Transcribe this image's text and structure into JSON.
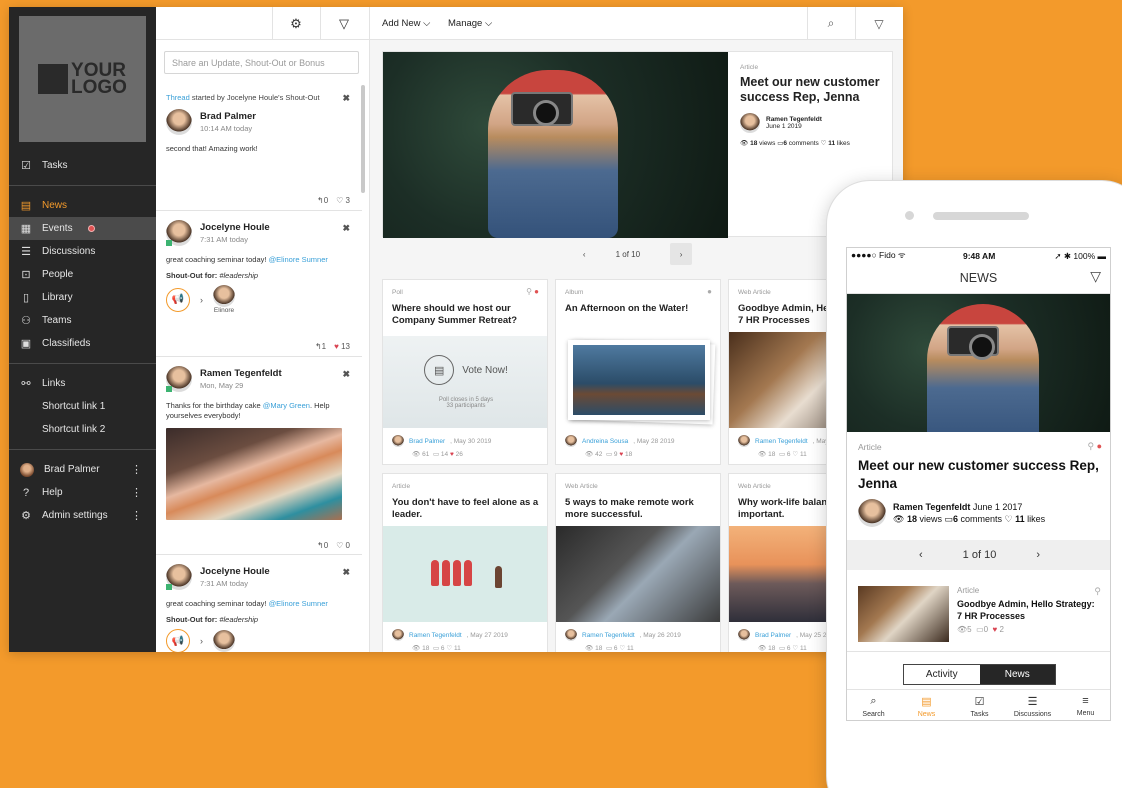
{
  "sidebar": {
    "logo_text": "YOUR LOGO",
    "items": [
      {
        "label": "Tasks",
        "icon": "tasks-icon"
      },
      {
        "label": "News",
        "icon": "news-icon"
      },
      {
        "label": "Events",
        "icon": "calendar-icon"
      },
      {
        "label": "Discussions",
        "icon": "discussions-icon"
      },
      {
        "label": "People",
        "icon": "people-icon"
      },
      {
        "label": "Library",
        "icon": "library-icon"
      },
      {
        "label": "Teams",
        "icon": "teams-icon"
      },
      {
        "label": "Classifieds",
        "icon": "classifieds-icon"
      }
    ],
    "links_label": "Links",
    "shortcuts": [
      "Shortcut link 1",
      "Shortcut link 2"
    ],
    "user": "Brad Palmer",
    "help": "Help",
    "admin": "Admin settings"
  },
  "feed": {
    "share_placeholder": "Share an Update, Shout-Out or Bonus",
    "posts": [
      {
        "thread_link": "Thread",
        "thread_rest": " started by Jocelyne Houle's Shout-Out",
        "author": "Brad Palmer",
        "time": "10:14 AM today",
        "text": "second that! Amazing work!",
        "replies": "0",
        "likes": "3"
      },
      {
        "author": "Jocelyne Houle",
        "time": "7:31 AM today",
        "text": "great coaching seminar today! ",
        "mention": "@Elinore Sumner",
        "shout_label": "Shout-Out for: ",
        "shout_tag": "#leadership",
        "recipient": "Elinore",
        "replies": "1",
        "likes": "13"
      },
      {
        "author": "Ramen Tegenfeldt",
        "time": "Mon, May 29",
        "text": "Thanks for the birthday cake ",
        "mention": "@Mary Green",
        "text2": ". Help yourselves everybody!",
        "replies": "0",
        "likes": "0"
      },
      {
        "author": "Jocelyne Houle",
        "time": "7:31 AM today",
        "text": "great coaching seminar today! ",
        "mention": "@Elinore Sumner",
        "shout_label": "Shout-Out for: ",
        "shout_tag": "#leadership"
      }
    ]
  },
  "main": {
    "add_new": "Add New ⌵",
    "manage": "Manage ⌵",
    "hero": {
      "category": "Article",
      "title": "Meet our new customer success Rep, Jenna",
      "author": "Ramen Tegenfeldt",
      "date": "June 1 2019",
      "views": "18",
      "comments": "6",
      "likes": "11"
    },
    "pager": "1 of 10",
    "cards": [
      {
        "category": "Poll",
        "title": "Where should we host our Company Summer Retreat?",
        "vote": "Vote Now!",
        "poll_note": "Poll closes in 5 days",
        "participants": "33 participants",
        "author": "Brad Palmer",
        "date": ", May 30 2019",
        "views": "61",
        "comments": "14",
        "likes": "26"
      },
      {
        "category": "Album",
        "title": "An Afternoon on the Water!",
        "author": "Andreina Sousa",
        "date": ", May 28 2019",
        "views": "42",
        "comments": "9",
        "likes": "18"
      },
      {
        "category": "Web Article",
        "title": "Goodbye Admin, Hello Strategy: 7 HR Processes",
        "author": "Ramen Tegenfeldt",
        "date": ", May 28 2019",
        "views": "18",
        "comments": "6",
        "likes": "11"
      },
      {
        "category": "Article",
        "title": "You don't have to feel alone as a leader.",
        "author": "Ramen Tegenfeldt",
        "date": ", May 27 2019",
        "views": "18",
        "comments": "6",
        "likes": "11"
      },
      {
        "category": "Web Article",
        "title": "5 ways to make remote work more successful.",
        "author": "Ramen Tegenfeldt",
        "date": ", May 26 2019",
        "views": "18",
        "comments": "6",
        "likes": "11"
      },
      {
        "category": "Web Article",
        "title": "Why work-life balance is important.",
        "author": "Brad Palmer",
        "date": ", May 25 2019",
        "views": "18",
        "comments": "6",
        "likes": "11"
      }
    ]
  },
  "phone": {
    "carrier": "●●●●○ Fido ᯤ",
    "time": "9:48 AM",
    "battery": "➚ ✱ 100% ▬",
    "header": "NEWS",
    "article_category": "Article",
    "article_title": "Meet our new customer success Rep, Jenna",
    "article_author": "Ramen Tegenfeldt",
    "article_date": " June 1 2017",
    "views": "18",
    "comments": "6",
    "likes": "11",
    "pager": "1 of 10",
    "item_category": "Article",
    "item_title": "Goodbye Admin, Hello Strategy: 7 HR Processes",
    "item_views": "5",
    "item_comments": "0",
    "item_likes": "2",
    "toggle": [
      "Activity",
      "News"
    ],
    "tabs": [
      "Search",
      "News",
      "Tasks",
      "Discussions",
      "Menu"
    ]
  }
}
